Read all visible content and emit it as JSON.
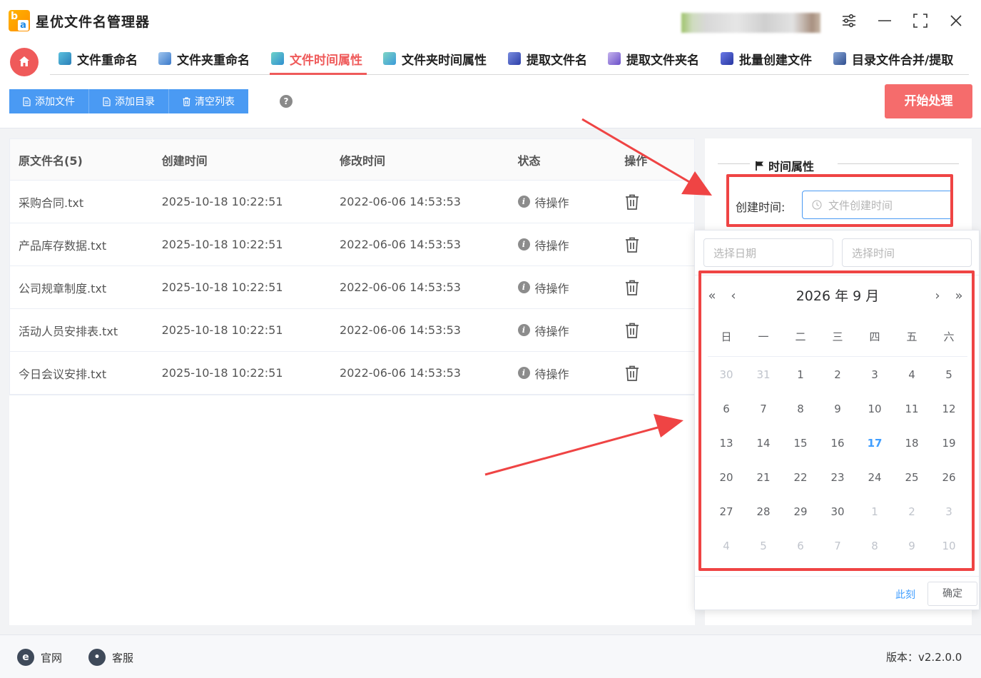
{
  "app": {
    "title": "星优文件名管理器",
    "logo_letter_top": "b",
    "logo_letter_bottom": "a"
  },
  "window_controls": [
    "settings-icon",
    "minimize-icon",
    "maximize-icon",
    "close-icon"
  ],
  "tabs": [
    {
      "label": "文件重命名",
      "icon": "file-rename-icon",
      "active": false
    },
    {
      "label": "文件夹重命名",
      "icon": "folder-rename-icon",
      "active": false
    },
    {
      "label": "文件时间属性",
      "icon": "file-time-icon",
      "active": true
    },
    {
      "label": "文件夹时间属性",
      "icon": "folder-time-icon",
      "active": false
    },
    {
      "label": "提取文件名",
      "icon": "extract-filename-icon",
      "active": false
    },
    {
      "label": "提取文件夹名",
      "icon": "extract-foldername-icon",
      "active": false
    },
    {
      "label": "批量创建文件",
      "icon": "batch-create-icon",
      "active": false
    },
    {
      "label": "目录文件合并/提取",
      "icon": "merge-extract-icon",
      "active": false
    }
  ],
  "toolbar": {
    "add_file": "添加文件",
    "add_dir": "添加目录",
    "clear_list": "清空列表",
    "help": "?",
    "start": "开始处理"
  },
  "table": {
    "headers": [
      "原文件名(5)",
      "创建时间",
      "修改时间",
      "状态",
      "操作"
    ],
    "rows": [
      {
        "name": "采购合同.txt",
        "created": "2025-10-18 10:22:51",
        "modified": "2022-06-06 14:53:53",
        "status": "待操作"
      },
      {
        "name": "产品库存数据.txt",
        "created": "2025-10-18 10:22:51",
        "modified": "2022-06-06 14:53:53",
        "status": "待操作"
      },
      {
        "name": "公司规章制度.txt",
        "created": "2025-10-18 10:22:51",
        "modified": "2022-06-06 14:53:53",
        "status": "待操作"
      },
      {
        "name": "活动人员安排表.txt",
        "created": "2025-10-18 10:22:51",
        "modified": "2022-06-06 14:53:53",
        "status": "待操作"
      },
      {
        "name": "今日会议安排.txt",
        "created": "2025-10-18 10:22:51",
        "modified": "2022-06-06 14:53:53",
        "status": "待操作"
      }
    ]
  },
  "time_panel": {
    "title": "时间属性",
    "create_label": "创建时间:",
    "create_placeholder": "文件创建时间"
  },
  "picker": {
    "date_placeholder": "选择日期",
    "time_placeholder": "选择时间",
    "title": "2026 年  9 月",
    "prev_year": "«",
    "prev_month": "‹",
    "next_month": "›",
    "next_year": "»",
    "weekdays": [
      "日",
      "一",
      "二",
      "三",
      "四",
      "五",
      "六"
    ],
    "weeks": [
      [
        {
          "d": "30",
          "o": true
        },
        {
          "d": "31",
          "o": true
        },
        {
          "d": "1"
        },
        {
          "d": "2"
        },
        {
          "d": "3"
        },
        {
          "d": "4"
        },
        {
          "d": "5"
        }
      ],
      [
        {
          "d": "6"
        },
        {
          "d": "7"
        },
        {
          "d": "8"
        },
        {
          "d": "9"
        },
        {
          "d": "10"
        },
        {
          "d": "11"
        },
        {
          "d": "12"
        }
      ],
      [
        {
          "d": "13"
        },
        {
          "d": "14"
        },
        {
          "d": "15"
        },
        {
          "d": "16"
        },
        {
          "d": "17",
          "t": true
        },
        {
          "d": "18"
        },
        {
          "d": "19"
        }
      ],
      [
        {
          "d": "20"
        },
        {
          "d": "21"
        },
        {
          "d": "22"
        },
        {
          "d": "23"
        },
        {
          "d": "24"
        },
        {
          "d": "25"
        },
        {
          "d": "26"
        }
      ],
      [
        {
          "d": "27"
        },
        {
          "d": "28"
        },
        {
          "d": "29"
        },
        {
          "d": "30"
        },
        {
          "d": "1",
          "o": true
        },
        {
          "d": "2",
          "o": true
        },
        {
          "d": "3",
          "o": true
        }
      ],
      [
        {
          "d": "4",
          "o": true
        },
        {
          "d": "5",
          "o": true
        },
        {
          "d": "6",
          "o": true
        },
        {
          "d": "7",
          "o": true
        },
        {
          "d": "8",
          "o": true
        },
        {
          "d": "9",
          "o": true
        },
        {
          "d": "10",
          "o": true
        }
      ]
    ],
    "now": "此刻",
    "confirm": "确定"
  },
  "footer": {
    "website": "官网",
    "support": "客服",
    "version": "版本：v2.2.0.0"
  },
  "colors": {
    "accent_red": "#ef5a5a",
    "primary_blue": "#4a9af3",
    "today_blue": "#409eff",
    "annotation_red": "#ef4444"
  }
}
